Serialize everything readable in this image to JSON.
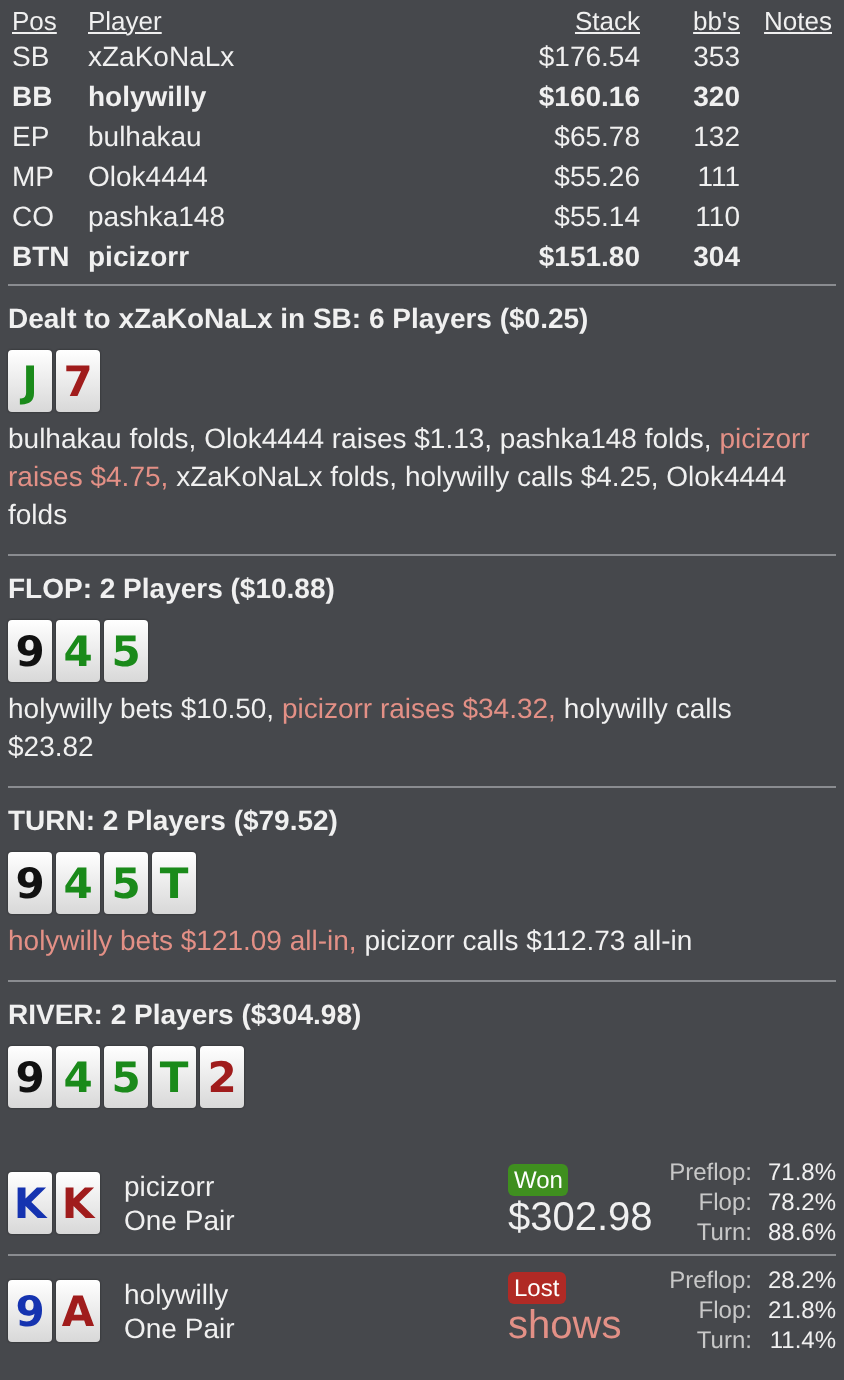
{
  "players_table": {
    "columns": [
      "Pos",
      "Player",
      "Stack",
      "bb's",
      "Notes"
    ],
    "rows": [
      {
        "pos": "SB",
        "player": "xZaKoNaLx",
        "stack": "$176.54",
        "bbs": "353",
        "bold": false
      },
      {
        "pos": "BB",
        "player": "holywilly",
        "stack": "$160.16",
        "bbs": "320",
        "bold": true
      },
      {
        "pos": "EP",
        "player": "bulhakau",
        "stack": "$65.78",
        "bbs": "132",
        "bold": false
      },
      {
        "pos": "MP",
        "player": "Olok4444",
        "stack": "$55.26",
        "bbs": "111",
        "bold": false
      },
      {
        "pos": "CO",
        "player": "pashka148",
        "stack": "$55.14",
        "bbs": "110",
        "bold": false
      },
      {
        "pos": "BTN",
        "player": "picizorr",
        "stack": "$151.80",
        "bbs": "304",
        "bold": true
      }
    ]
  },
  "streets": [
    {
      "title": "Dealt to xZaKoNaLx in SB: 6 Players ($0.25)",
      "cards": [
        {
          "rank": "J",
          "color": "#1a8a1a"
        },
        {
          "rank": "7",
          "color": "#a01c1c"
        }
      ],
      "actions": [
        {
          "text": "bulhakau folds, Olok4444 raises $1.13, pashka148 folds,",
          "highlighted": false
        },
        {
          "text": "picizorr raises $4.75,",
          "highlighted": true
        },
        {
          "text": "xZaKoNaLx folds, holywilly calls $4.25, Olok4444 folds",
          "highlighted": false
        }
      ]
    },
    {
      "title": "FLOP: 2 Players ($10.88)",
      "cards": [
        {
          "rank": "9",
          "color": "#111111"
        },
        {
          "rank": "4",
          "color": "#1a8a1a"
        },
        {
          "rank": "5",
          "color": "#1a8a1a"
        }
      ],
      "actions": [
        {
          "text": "holywilly bets $10.50,",
          "highlighted": false
        },
        {
          "text": "picizorr raises $34.32,",
          "highlighted": true
        },
        {
          "text": "holywilly calls $23.82",
          "highlighted": false
        }
      ]
    },
    {
      "title": "TURN: 2 Players ($79.52)",
      "cards": [
        {
          "rank": "9",
          "color": "#111111"
        },
        {
          "rank": "4",
          "color": "#1a8a1a"
        },
        {
          "rank": "5",
          "color": "#1a8a1a"
        },
        {
          "rank": "T",
          "color": "#1a8a1a"
        }
      ],
      "actions": [
        {
          "text": "holywilly bets $121.09 all-in,",
          "highlighted": true
        },
        {
          "text": "picizorr calls $112.73 all-in",
          "highlighted": false
        }
      ]
    },
    {
      "title": "RIVER: 2 Players ($304.98)",
      "cards": [
        {
          "rank": "9",
          "color": "#111111"
        },
        {
          "rank": "4",
          "color": "#1a8a1a"
        },
        {
          "rank": "5",
          "color": "#1a8a1a"
        },
        {
          "rank": "T",
          "color": "#1a8a1a"
        },
        {
          "rank": "2",
          "color": "#a01c1c"
        }
      ]
    }
  ],
  "showdown": [
    {
      "cards": [
        {
          "rank": "K",
          "color": "#1533b0"
        },
        {
          "rank": "K",
          "color": "#a01c1c"
        }
      ],
      "player": "picizorr",
      "hand": "One Pair",
      "won": true,
      "result_label": "Won",
      "amount": "$302.98",
      "equity": [
        {
          "label": "Preflop:",
          "value": "71.8%"
        },
        {
          "label": "Flop:",
          "value": "78.2%"
        },
        {
          "label": "Turn:",
          "value": "88.6%"
        }
      ]
    },
    {
      "cards": [
        {
          "rank": "9",
          "color": "#1533b0"
        },
        {
          "rank": "A",
          "color": "#a01c1c"
        }
      ],
      "player": "holywilly",
      "hand": "One Pair",
      "won": false,
      "result_label": "Lost",
      "amount": "shows",
      "equity": [
        {
          "label": "Preflop:",
          "value": "28.2%"
        },
        {
          "label": "Flop:",
          "value": "21.8%"
        },
        {
          "label": "Turn:",
          "value": "11.4%"
        }
      ]
    }
  ]
}
